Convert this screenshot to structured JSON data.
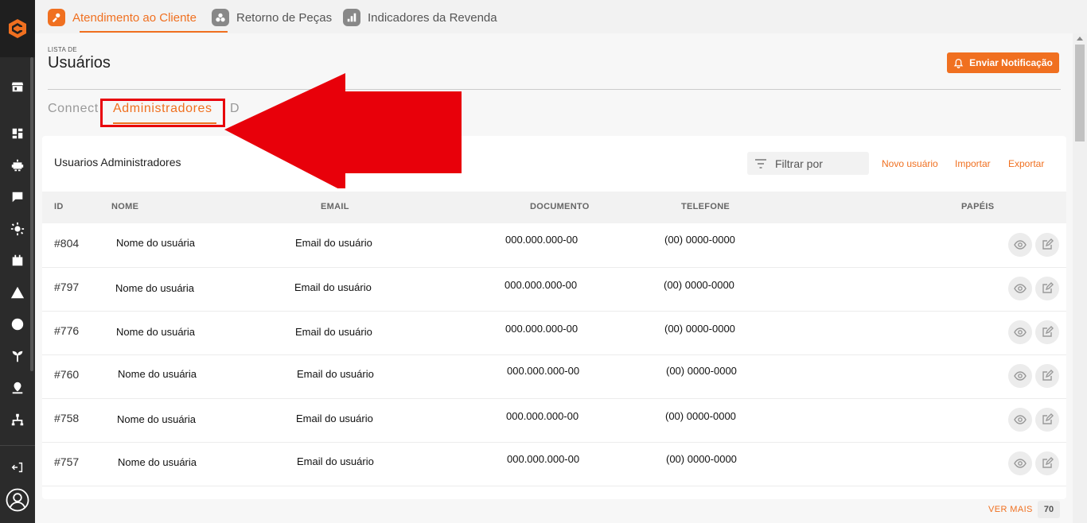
{
  "top_tabs": [
    {
      "label": "Atendimento ao Cliente",
      "icon": "wrench-person-icon",
      "active": true
    },
    {
      "label": "Retorno de Peças",
      "icon": "parts-cluster-icon",
      "active": false
    },
    {
      "label": "Indicadores da Revenda",
      "icon": "bar-chart-icon",
      "active": false
    }
  ],
  "sidebar": {
    "logo": "brand-c-logo",
    "items": [
      "store-icon",
      "dashboard-icon",
      "robot-icon",
      "chat-icon",
      "gear-cog-icon",
      "calendar-icon",
      "warning-icon",
      "globe-icon",
      "plant-icon",
      "location-icon",
      "network-icon"
    ],
    "bottom": [
      "logout-icon",
      "user-avatar-icon"
    ]
  },
  "page": {
    "subtitle": "LISTA DE",
    "title": "Usuários",
    "notify_button": "Enviar Notificação"
  },
  "sub_tabs": [
    {
      "label": "Connect",
      "active": false
    },
    {
      "label": "Administradores",
      "active": true
    },
    {
      "label": "D",
      "active": false
    }
  ],
  "card": {
    "title": "Usuarios Administradores",
    "filter_placeholder": "Filtrar por",
    "links": [
      "Novo usuário",
      "Importar",
      "Exportar"
    ]
  },
  "table": {
    "columns": [
      "ID",
      "NOME",
      "EMAIL",
      "DOCUMENTO",
      "TELEFONE",
      "PAPÉIS"
    ],
    "rows": [
      {
        "id": "#804",
        "nome": "Nome do usuária",
        "email": "Email do usuário",
        "documento": "000.000.000-00",
        "telefone": "(00) 0000-0000"
      },
      {
        "id": "#797",
        "nome": "Nome do usuária",
        "email": "Email do usuário",
        "documento": "000.000.000-00",
        "telefone": "(00) 0000-0000"
      },
      {
        "id": "#776",
        "nome": "Nome do usuária",
        "email": "Email do usuário",
        "documento": "000.000.000-00",
        "telefone": "(00) 0000-0000"
      },
      {
        "id": "#760",
        "nome": "Nome do usuária",
        "email": "Email do usuário",
        "documento": "000.000.000-00",
        "telefone": "(00) 0000-0000"
      },
      {
        "id": "#758",
        "nome": "Nome do usuária",
        "email": "Email do usuário",
        "documento": "000.000.000-00",
        "telefone": "(00) 0000-0000"
      },
      {
        "id": "#757",
        "nome": "Nome do usuária",
        "email": "Email do usuário",
        "documento": "000.000.000-00",
        "telefone": "(00) 0000-0000"
      }
    ]
  },
  "footer": {
    "ver_mais": "VER MAIS",
    "count": "70"
  },
  "colors": {
    "accent": "#f07020",
    "sidebar": "#2b2b2b",
    "annotation": "#e8000a"
  }
}
